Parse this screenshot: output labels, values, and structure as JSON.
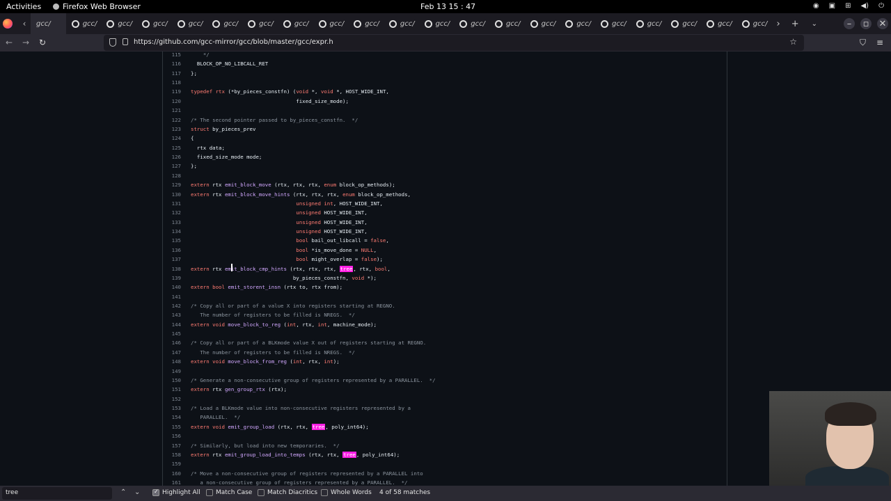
{
  "topbar": {
    "activities": "Activities",
    "app_name": "Firefox Web Browser",
    "clock": "Feb 13  15 : 47"
  },
  "tabs": {
    "first_label": "gcc/",
    "label": "gcc/"
  },
  "navbar": {
    "url": "https://github.com/gcc-mirror/gcc/blob/master/gcc/expr.h"
  },
  "code": {
    "lines": [
      {
        "n": "115",
        "html": "    <span class=\"cm\">*/</span>"
      },
      {
        "n": "116",
        "html": "  BLOCK_OP_NO_LIBCALL_RET"
      },
      {
        "n": "117",
        "html": "};"
      },
      {
        "n": "118",
        "html": ""
      },
      {
        "n": "119",
        "html": "<span class=\"kw\">typedef</span> <span class=\"kw\">rtx</span> (*by_pieces_constfn) (<span class=\"kw\">void</span> *, <span class=\"kw\">void</span> *, HOST_WIDE_INT,"
      },
      {
        "n": "120",
        "html": "                                  fixed_size_mode);"
      },
      {
        "n": "121",
        "html": ""
      },
      {
        "n": "122",
        "html": "<span class=\"cm\">/* The second pointer passed to by_pieces_constfn.  */</span>"
      },
      {
        "n": "123",
        "html": "<span class=\"kw\">struct</span> by_pieces_prev"
      },
      {
        "n": "124",
        "html": "{"
      },
      {
        "n": "125",
        "html": "  rtx data;"
      },
      {
        "n": "126",
        "html": "  fixed_size_mode mode;"
      },
      {
        "n": "127",
        "html": "};"
      },
      {
        "n": "128",
        "html": ""
      },
      {
        "n": "129",
        "html": "<span class=\"kw\">extern</span> rtx <span class=\"fn\">emit_block_move</span> (rtx, rtx, rtx, <span class=\"kw\">enum</span> block_op_methods);"
      },
      {
        "n": "130",
        "html": "<span class=\"kw\">extern</span> rtx <span class=\"fn\">emit_block_move_hints</span> (rtx, rtx, rtx, <span class=\"kw\">enum</span> block_op_methods,"
      },
      {
        "n": "131",
        "html": "                                  <span class=\"kw\">unsigned</span> <span class=\"kw\">int</span>, HOST_WIDE_INT,"
      },
      {
        "n": "132",
        "html": "                                  <span class=\"kw\">unsigned</span> HOST_WIDE_INT,"
      },
      {
        "n": "133",
        "html": "                                  <span class=\"kw\">unsigned</span> HOST_WIDE_INT,"
      },
      {
        "n": "134",
        "html": "                                  <span class=\"kw\">unsigned</span> HOST_WIDE_INT,"
      },
      {
        "n": "135",
        "html": "                                  <span class=\"kw\">bool</span> bail_out_libcall = <span class=\"kw\">false</span>,"
      },
      {
        "n": "136",
        "html": "                                  <span class=\"kw\">bool</span> *is_move_done = <span class=\"kw\">NULL</span>,"
      },
      {
        "n": "137",
        "html": "                                  <span class=\"kw\">bool</span> might_overlap = <span class=\"kw\">false</span>);"
      },
      {
        "n": "138",
        "html": "<span class=\"kw\">extern</span> rtx <span class=\"fn\">emit_block_cmp_hints</span> (rtx, rtx, rtx, <span class=\"hl\">tree</span>, rtx, <span class=\"kw\">bool</span>,"
      },
      {
        "n": "139",
        "html": "                                 by_pieces_constfn, <span class=\"kw\">void</span> *);"
      },
      {
        "n": "140",
        "html": "<span class=\"kw\">extern</span> <span class=\"kw\">bool</span> <span class=\"fn\">emit_storent_insn</span> (rtx to, rtx from);"
      },
      {
        "n": "141",
        "html": ""
      },
      {
        "n": "142",
        "html": "<span class=\"cm\">/* Copy all or part of a value X into registers starting at REGNO.</span>"
      },
      {
        "n": "143",
        "html": "<span class=\"cm\">   The number of registers to be filled is NREGS.  */</span>"
      },
      {
        "n": "144",
        "html": "<span class=\"kw\">extern</span> <span class=\"kw\">void</span> <span class=\"fn\">move_block_to_reg</span> (<span class=\"kw\">int</span>, rtx, <span class=\"kw\">int</span>, machine_mode);"
      },
      {
        "n": "145",
        "html": ""
      },
      {
        "n": "146",
        "html": "<span class=\"cm\">/* Copy all or part of a BLKmode value X out of registers starting at REGNO.</span>"
      },
      {
        "n": "147",
        "html": "<span class=\"cm\">   The number of registers to be filled is NREGS.  */</span>"
      },
      {
        "n": "148",
        "html": "<span class=\"kw\">extern</span> <span class=\"kw\">void</span> <span class=\"fn\">move_block_from_reg</span> (<span class=\"kw\">int</span>, rtx, <span class=\"kw\">int</span>);"
      },
      {
        "n": "149",
        "html": ""
      },
      {
        "n": "150",
        "html": "<span class=\"cm\">/* Generate a non-consecutive group of registers represented by a PARALLEL.  */</span>"
      },
      {
        "n": "151",
        "html": "<span class=\"kw\">extern</span> rtx <span class=\"fn\">gen_group_rtx</span> (rtx);"
      },
      {
        "n": "152",
        "html": ""
      },
      {
        "n": "153",
        "html": "<span class=\"cm\">/* Load a BLKmode value into non-consecutive registers represented by a</span>"
      },
      {
        "n": "154",
        "html": "<span class=\"cm\">   PARALLEL.  */</span>"
      },
      {
        "n": "155",
        "html": "<span class=\"kw\">extern</span> <span class=\"kw\">void</span> <span class=\"fn\">emit_group_load</span> (rtx, rtx, <span class=\"hl\">tree</span>, poly_int64);"
      },
      {
        "n": "156",
        "html": ""
      },
      {
        "n": "157",
        "html": "<span class=\"cm\">/* Similarly, but load into new temporaries.  */</span>"
      },
      {
        "n": "158",
        "html": "<span class=\"kw\">extern</span> rtx <span class=\"fn\">emit_group_load_into_temps</span> (rtx, rtx, <span class=\"hl\">tree</span>, poly_int64);"
      },
      {
        "n": "159",
        "html": ""
      },
      {
        "n": "160",
        "html": "<span class=\"cm\">/* Move a non-consecutive group of registers represented by a PARALLEL into</span>"
      },
      {
        "n": "161",
        "html": "<span class=\"cm\">   a non-consecutive group of registers represented by a PARALLEL.  */</span>"
      }
    ]
  },
  "findbar": {
    "query": "tree",
    "highlight_all": "Highlight All",
    "match_case": "Match Case",
    "match_diacritics": "Match Diacritics",
    "whole_words": "Whole Words",
    "status": "4 of 58 matches"
  },
  "colors": {
    "highlight": "#ff1fe5",
    "keyword": "#ff7b72",
    "function": "#d2a8ff",
    "comment": "#8b949e"
  }
}
